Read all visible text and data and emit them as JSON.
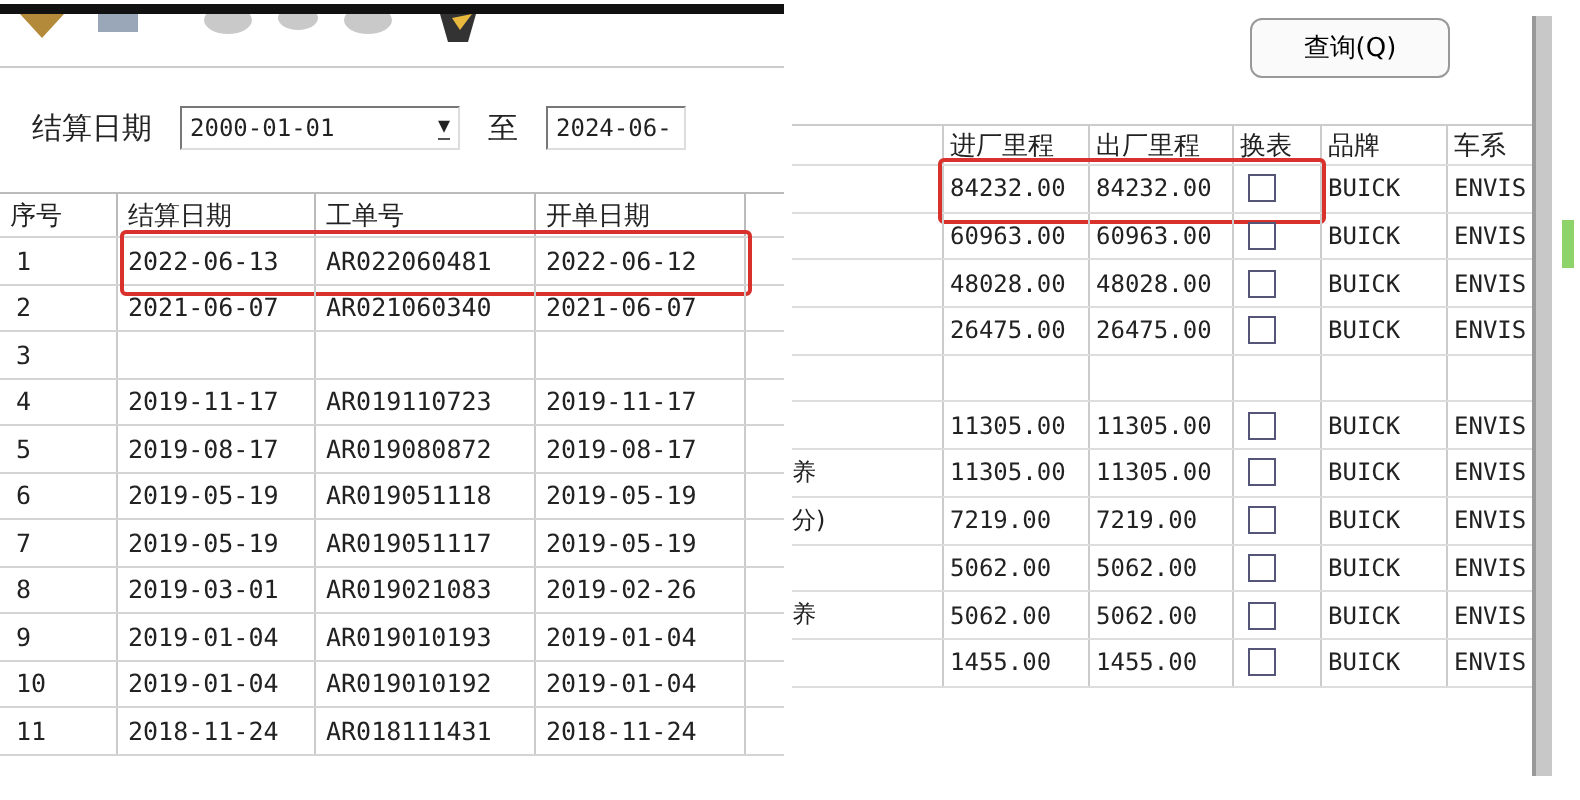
{
  "left": {
    "filter": {
      "label": "结算日期",
      "from": "2000-01-01",
      "dropdown": "▼",
      "to_label": "至",
      "to": "2024-06-"
    },
    "columns": [
      "序号",
      "结算日期",
      "工单号",
      "开单日期"
    ],
    "rows": [
      {
        "no": "1",
        "settle": "2022-06-13",
        "order": "AR022060481",
        "open": "2022-06-12",
        "highlighted": true
      },
      {
        "no": "2",
        "settle": "2021-06-07",
        "order": "AR021060340",
        "open": "2021-06-07",
        "highlighted": false
      },
      {
        "no": "3",
        "highlighted": false
      },
      {
        "no": "4",
        "settle": "2019-11-17",
        "order": "AR019110723",
        "open": "2019-11-17",
        "highlighted": false
      },
      {
        "no": "5",
        "settle": "2019-08-17",
        "order": "AR019080872",
        "open": "2019-08-17",
        "highlighted": false
      },
      {
        "no": "6",
        "settle": "2019-05-19",
        "order": "AR019051118",
        "open": "2019-05-19",
        "highlighted": false
      },
      {
        "no": "7",
        "settle": "2019-05-19",
        "order": "AR019051117",
        "open": "2019-05-19",
        "highlighted": false
      },
      {
        "no": "8",
        "settle": "2019-03-01",
        "order": "AR019021083",
        "open": "2019-02-26",
        "highlighted": false
      },
      {
        "no": "9",
        "settle": "2019-01-04",
        "order": "AR019010193",
        "open": "2019-01-04",
        "highlighted": false
      },
      {
        "no": "10",
        "settle": "2019-01-04",
        "order": "AR019010192",
        "open": "2019-01-04",
        "highlighted": false
      },
      {
        "no": "11",
        "settle": "2018-11-24",
        "order": "AR018111431",
        "open": "2018-11-24",
        "highlighted": false
      }
    ]
  },
  "right": {
    "query_button": "查询(Q)",
    "columns": [
      "进厂里程",
      "出厂里程",
      "换表",
      "品牌",
      "车系"
    ],
    "rows": [
      {
        "in": "84232.00",
        "out": "84232.00",
        "checked": false,
        "brand": "BUICK",
        "series": "ENVIS",
        "highlighted": true
      },
      {
        "in": "60963.00",
        "out": "60963.00",
        "checked": false,
        "brand": "BUICK",
        "series": "ENVIS",
        "highlighted": false
      },
      {
        "in": "48028.00",
        "out": "48028.00",
        "checked": false,
        "brand": "BUICK",
        "series": "ENVIS",
        "highlighted": false
      },
      {
        "in": "26475.00",
        "out": "26475.00",
        "checked": false,
        "brand": "BUICK",
        "series": "ENVIS",
        "highlighted": false
      },
      {
        "highlighted": false
      },
      {
        "in": "11305.00",
        "out": "11305.00",
        "checked": false,
        "brand": "BUICK",
        "series": "ENVIS",
        "highlighted": false
      },
      {
        "note": "养",
        "in": "11305.00",
        "out": "11305.00",
        "checked": false,
        "brand": "BUICK",
        "series": "ENVIS",
        "highlighted": false
      },
      {
        "note": "分)",
        "in": "7219.00",
        "out": "7219.00",
        "checked": false,
        "brand": "BUICK",
        "series": "ENVIS",
        "highlighted": false
      },
      {
        "in": "5062.00",
        "out": "5062.00",
        "checked": false,
        "brand": "BUICK",
        "series": "ENVIS",
        "highlighted": false
      },
      {
        "note": "养",
        "in": "5062.00",
        "out": "5062.00",
        "checked": false,
        "brand": "BUICK",
        "series": "ENVIS",
        "highlighted": false
      },
      {
        "in": "1455.00",
        "out": "1455.00",
        "checked": false,
        "brand": "BUICK",
        "series": "ENVIS",
        "highlighted": false
      }
    ]
  }
}
